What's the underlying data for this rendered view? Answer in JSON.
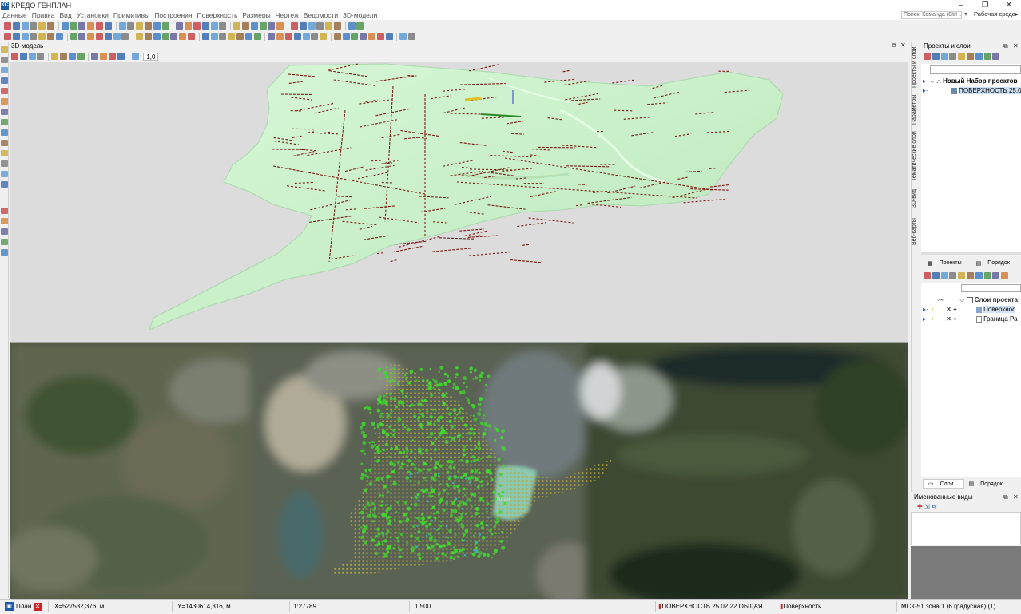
{
  "app": {
    "title": "КРЕДО ГЕНПЛАН",
    "logo": "КС"
  },
  "menu": [
    "Данные",
    "Правка",
    "Вид",
    "Установки",
    "Примитивы",
    "Построения",
    "Поверхность",
    "Размеры",
    "Чертеж",
    "Ведомости",
    "3D-модели"
  ],
  "search": {
    "placeholder": "Поиск: Команда (Ctrl ..."
  },
  "workspace": {
    "label": "Рабочая среда▸"
  },
  "view3d": {
    "title": "3D-модель",
    "toolbar": {
      "zoom_value": "1,0"
    },
    "colors": {
      "surface": "#c8f0c8",
      "background": "#dcdcdc",
      "breaklines": "#7a1a10"
    }
  },
  "plan": {
    "watermark": "ПЛАН",
    "colors": {
      "points_yellow": "#b8a83a",
      "points_green": "#3fd92c"
    }
  },
  "right_tabs": [
    "Проекты и слои",
    "Параметры",
    "Тематические слои",
    "3D-вид",
    "Веб-карты"
  ],
  "projects_panel": {
    "title": "Проекты и слои",
    "tree": {
      "root": "Новый Набор проектов",
      "child": "ПОВЕРХНОСТЬ 25.0"
    },
    "tabs": [
      "Проекты",
      "Порядок"
    ]
  },
  "layers_panel": {
    "root": "Слои проекта:",
    "items": [
      "Поверхнос",
      "Граница Ра"
    ],
    "tabs": [
      "Слои",
      "Порядок"
    ]
  },
  "named_views": {
    "title": "Именованные виды"
  },
  "status": {
    "tab_label": "План",
    "x": "X=527532,376, м",
    "y": "Y=1430614,316, м",
    "scale1": "1:27789",
    "scale2": "1:500",
    "project": "ПОВЕРХНОСТЬ 25.02.22 ОБЩАЯ",
    "layer": "Поверхность",
    "crs": "МСК-51 зона 1 (6 градусная) (1)"
  }
}
